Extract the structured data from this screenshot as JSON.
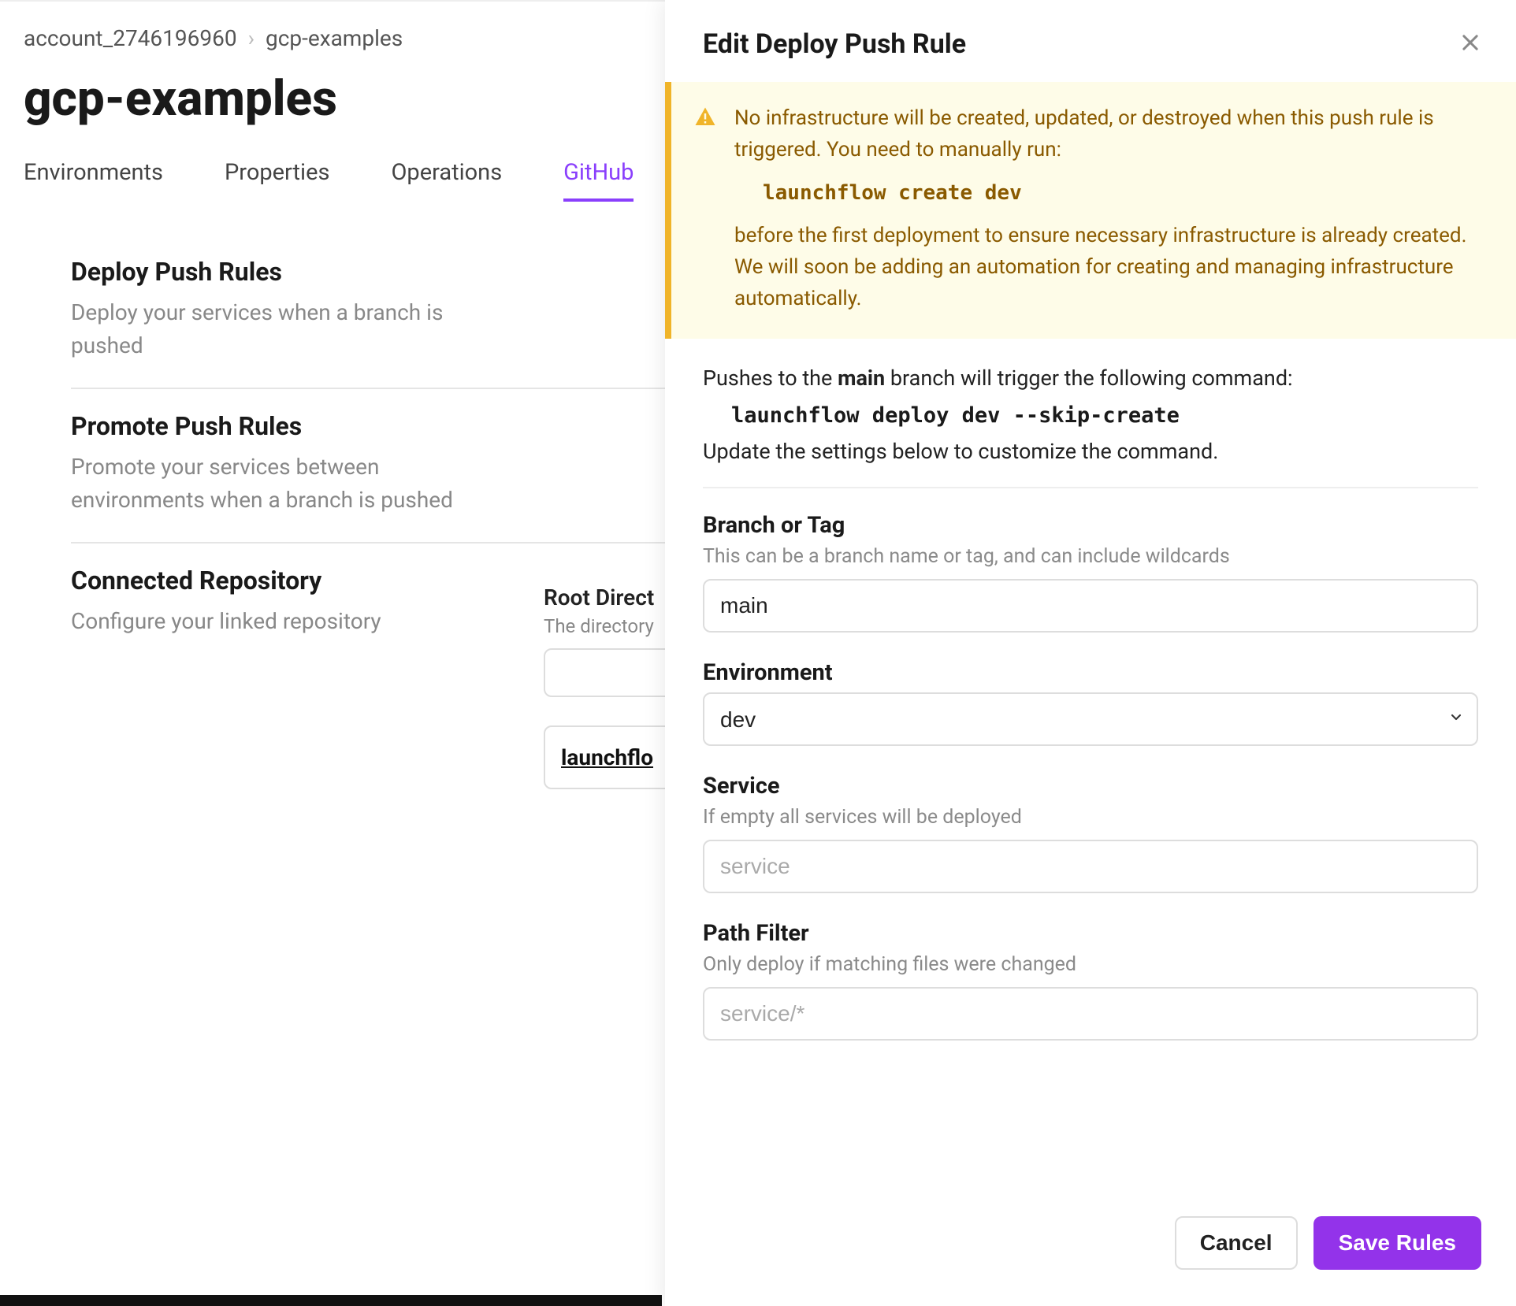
{
  "breadcrumb": {
    "account": "account_2746196960",
    "project": "gcp-examples"
  },
  "page_title": "gcp-examples",
  "tabs": [
    "Environments",
    "Properties",
    "Operations",
    "GitHub"
  ],
  "active_tab_index": 3,
  "sections": [
    {
      "title": "Deploy Push Rules",
      "desc": "Deploy your services when a branch is pushed"
    },
    {
      "title": "Promote Push Rules",
      "desc": "Promote your services between environments when a branch is pushed"
    },
    {
      "title": "Connected Repository",
      "desc": "Configure your linked repository"
    }
  ],
  "repo": {
    "root_label": "Root Direct",
    "root_sub": "The directory",
    "root_value": "",
    "link_text": "launchflo"
  },
  "panel": {
    "title": "Edit Deploy Push Rule",
    "warning": {
      "line1": "No infrastructure will be created, updated, or destroyed when this push rule is triggered. You need to manually run:",
      "cmd": "launchflow create dev",
      "line2": "before the first deployment to ensure necessary infrastructure is already created. We will soon be adding an automation for creating and managing infrastructure automatically."
    },
    "intro_prefix": "Pushes to the ",
    "intro_branch": "main",
    "intro_suffix": " branch will trigger the following command:",
    "intro_cmd": "launchflow deploy dev --skip-create",
    "intro_update": "Update the settings below to customize the command.",
    "form": {
      "branch": {
        "label": "Branch or Tag",
        "hint": "This can be a branch name or tag, and can include wildcards",
        "value": "main"
      },
      "environment": {
        "label": "Environment",
        "value": "dev"
      },
      "service": {
        "label": "Service",
        "hint": "If empty all services will be deployed",
        "placeholder": "service",
        "value": ""
      },
      "path_filter": {
        "label": "Path Filter",
        "hint": "Only deploy if matching files were changed",
        "placeholder": "service/*",
        "value": ""
      }
    },
    "buttons": {
      "cancel": "Cancel",
      "save": "Save Rules"
    }
  }
}
